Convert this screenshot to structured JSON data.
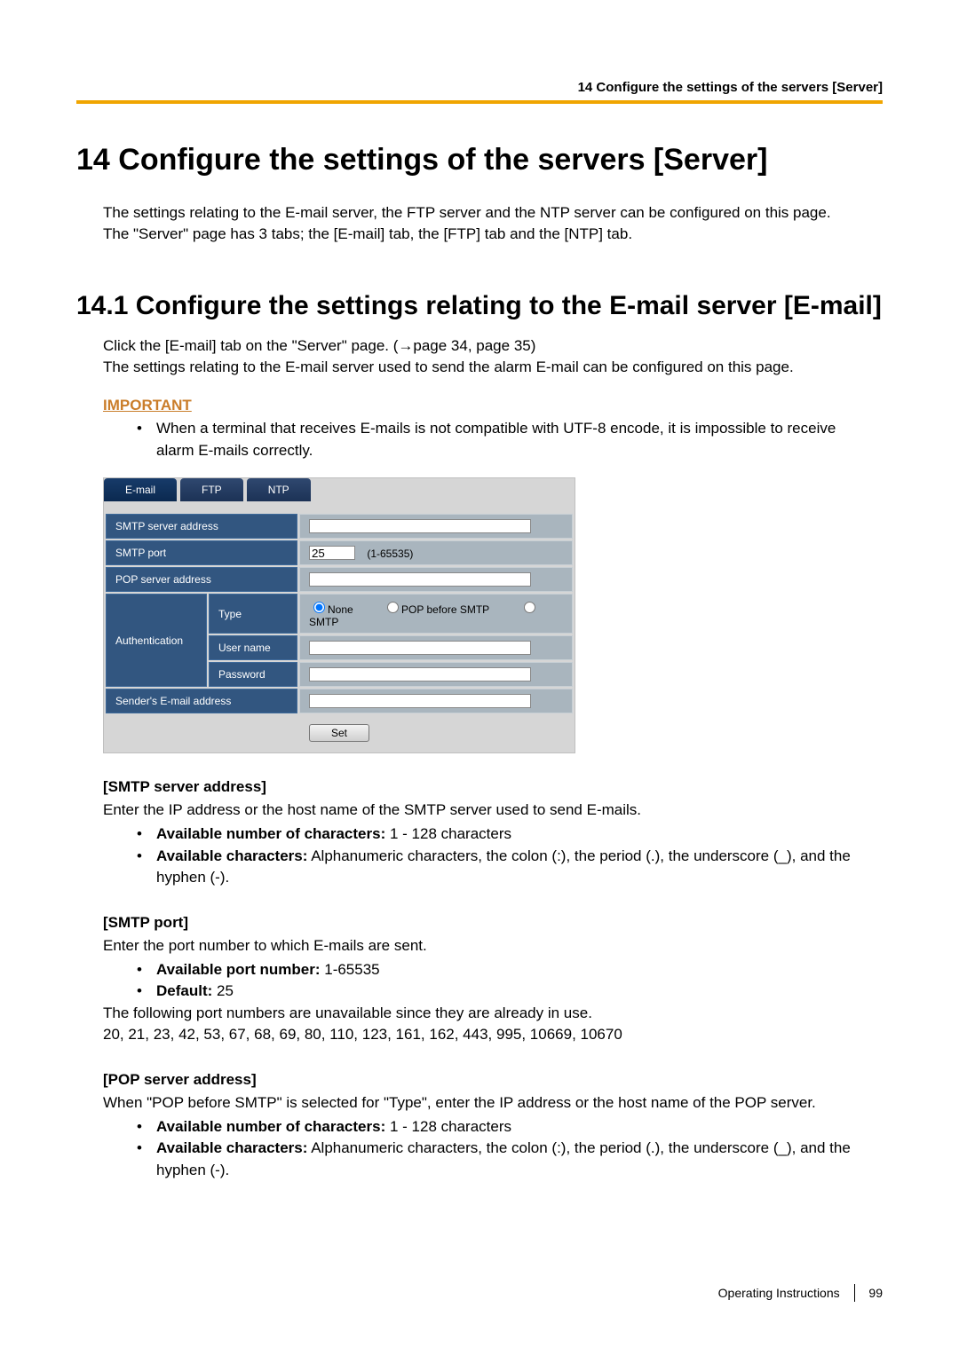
{
  "running_head": "14 Configure the settings of the servers [Server]",
  "h1": "14   Configure the settings of the servers [Server]",
  "intro_1": "The settings relating to the E-mail server, the FTP server and the NTP server can be configured on this page. The \"Server\" page has 3 tabs; the [E-mail] tab, the [FTP] tab and the [NTP] tab.",
  "h2": "14.1  Configure the settings relating to the E-mail server [E-mail]",
  "p14_1a": "Click the [E-mail] tab on the \"Server\" page. (→page 34, page 35)",
  "p14_1b": "The settings relating to the E-mail server used to send the alarm E-mail can be configured on this page.",
  "important_label": "IMPORTANT",
  "important_item": "When a terminal that receives E-mails is not compatible with UTF-8 encode, it is impossible to receive alarm E-mails correctly.",
  "tabs": {
    "email": "E-mail",
    "ftp": "FTP",
    "ntp": "NTP"
  },
  "form": {
    "smtp_addr_label": "SMTP server address",
    "smtp_port_label": "SMTP port",
    "smtp_port_value": "25",
    "smtp_port_range": "(1-65535)",
    "pop_addr_label": "POP server address",
    "auth_label": "Authentication",
    "auth_type_label": "Type",
    "auth_user_label": "User name",
    "auth_pw_label": "Password",
    "auth_type_none": "None",
    "auth_type_pop": "POP before SMTP",
    "auth_type_smtp": "SMTP",
    "sender_label": "Sender's E-mail address",
    "set_btn": "Set"
  },
  "smtp_addr_h": "[SMTP server address]",
  "smtp_addr_p": "Enter the IP address or the host name of the SMTP server used to send E-mails.",
  "smtp_addr_b1a": "Available number of characters:",
  "smtp_addr_b1b": " 1 - 128 characters",
  "smtp_addr_b2a": "Available characters:",
  "smtp_addr_b2b": " Alphanumeric characters, the colon (:), the period (.), the underscore (_), and the hyphen (-).",
  "smtp_port_h": "[SMTP port]",
  "smtp_port_p": "Enter the port number to which E-mails are sent.",
  "smtp_port_b1a": "Available port number:",
  "smtp_port_b1b": " 1-65535",
  "smtp_port_b2a": "Default:",
  "smtp_port_b2b": " 25",
  "smtp_port_p2": "The following port numbers are unavailable since they are already in use.",
  "smtp_port_p3": "20, 21, 23, 42, 53, 67, 68, 69, 80, 110, 123, 161, 162, 443, 995, 10669, 10670",
  "pop_addr_h": "[POP server address]",
  "pop_addr_p": "When \"POP before SMTP\" is selected for \"Type\", enter the IP address or the host name of the POP server.",
  "pop_addr_b1a": "Available number of characters:",
  "pop_addr_b1b": " 1 - 128 characters",
  "pop_addr_b2a": "Available characters:",
  "pop_addr_b2b": " Alphanumeric characters, the colon (:), the period (.), the underscore (_), and the hyphen (-).",
  "footer_doc": "Operating Instructions",
  "footer_page": "99"
}
